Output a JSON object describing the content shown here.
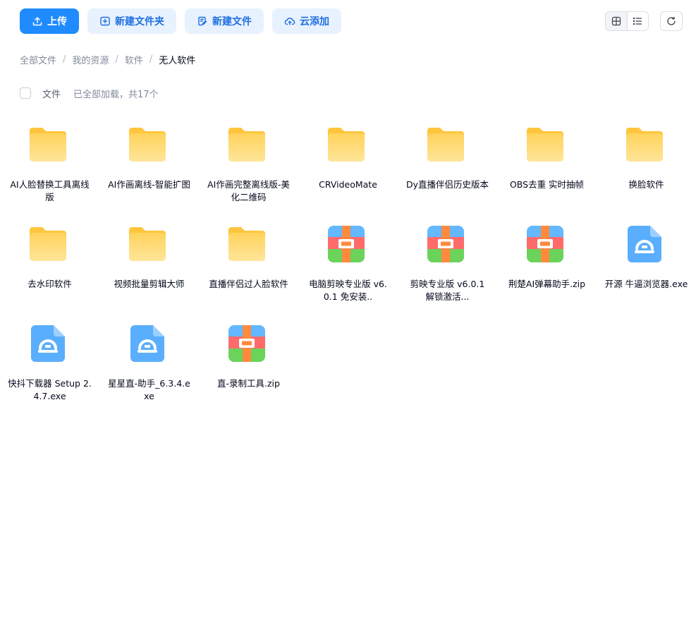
{
  "toolbar": {
    "upload": "上传",
    "new_folder": "新建文件夹",
    "new_file": "新建文件",
    "cloud_add": "云添加"
  },
  "breadcrumb": [
    "全部文件",
    "我的资源",
    "软件",
    "无人软件"
  ],
  "selection": {
    "label": "文件",
    "status": "已全部加载，共17个"
  },
  "colors": {
    "primary": "#1f8bff",
    "light_button": "#e8f2fe",
    "folder": "#ffd35c"
  },
  "files": [
    {
      "name": "AI人脸替换工具离线版",
      "icon": "folder-icon"
    },
    {
      "name": "AI作画离线-智能扩图",
      "icon": "folder-icon"
    },
    {
      "name": "AI作画完整离线版-美化二维码",
      "icon": "folder-icon"
    },
    {
      "name": "CRVideoMate",
      "icon": "folder-icon"
    },
    {
      "name": "Dy直播伴侣历史版本",
      "icon": "folder-icon"
    },
    {
      "name": "OBS去重 实时抽帧",
      "icon": "folder-icon"
    },
    {
      "name": "换脸软件",
      "icon": "folder-icon"
    },
    {
      "name": "去水印软件",
      "icon": "folder-icon"
    },
    {
      "name": "视频批量剪辑大师",
      "icon": "folder-icon"
    },
    {
      "name": "直播伴侣过人脸软件",
      "icon": "folder-icon"
    },
    {
      "name": "电脑剪映专业版 v6.0.1 免安装..",
      "icon": "archive-icon"
    },
    {
      "name": "剪映专业版 v6.0.1 解锁激活...",
      "icon": "archive-icon"
    },
    {
      "name": "荆楚AI弹幕助手.zip",
      "icon": "archive-icon"
    },
    {
      "name": "开源 牛逼浏览器.exe",
      "icon": "exe-icon"
    },
    {
      "name": "快抖下载器 Setup 2.4.7.exe",
      "icon": "exe-icon"
    },
    {
      "name": "星星直-助手_6.3.4.exe",
      "icon": "exe-icon"
    },
    {
      "name": "直-录制工具.zip",
      "icon": "archive-icon"
    }
  ]
}
